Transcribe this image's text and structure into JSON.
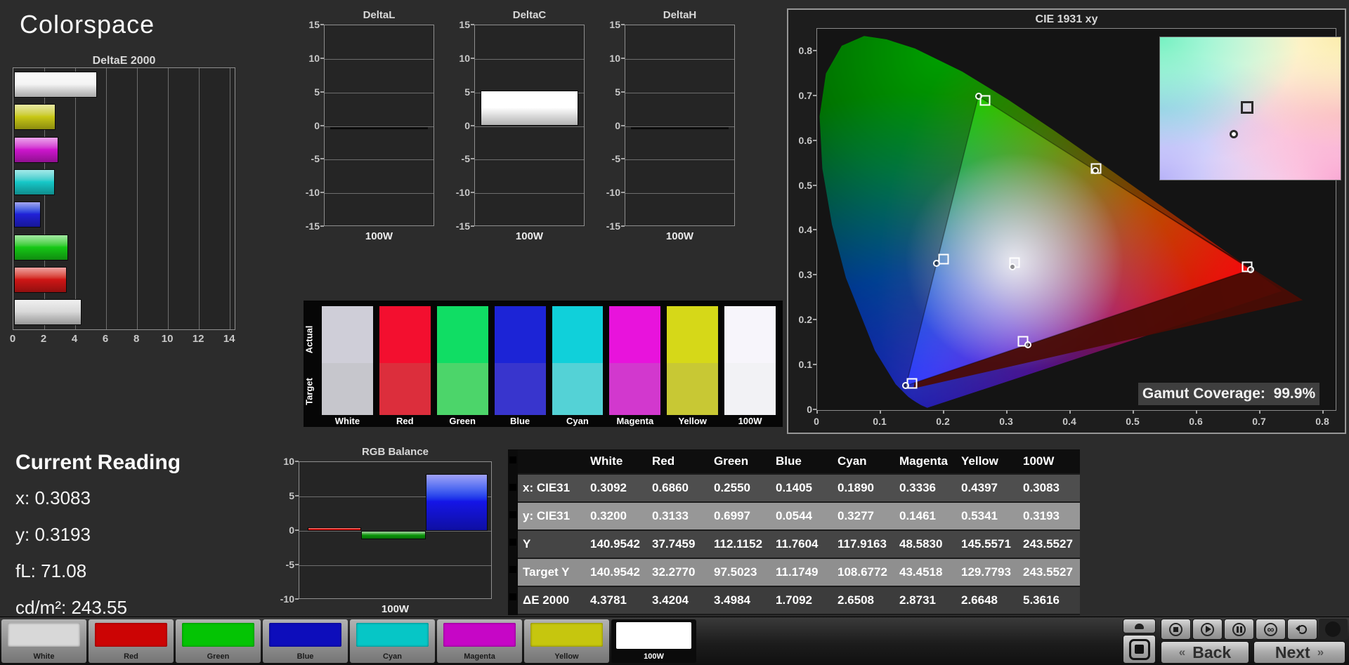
{
  "app": {
    "title": "Colorspace"
  },
  "current_reading": {
    "title": "Current Reading",
    "lines": [
      "x: 0.3083",
      "y: 0.3193",
      "fL: 71.08",
      "cd/m²: 243.55"
    ]
  },
  "chart_data": [
    {
      "id": "deltae2000",
      "type": "bar",
      "orientation": "horizontal",
      "title": "DeltaE 2000",
      "xlim": [
        0,
        14.4
      ],
      "xticks": [
        0,
        2,
        4,
        6,
        8,
        10,
        12,
        14
      ],
      "categories": [
        "100W",
        "Yellow",
        "Magenta",
        "Cyan",
        "Blue",
        "Green",
        "Red",
        "White"
      ],
      "values": [
        5.3616,
        2.6648,
        2.8731,
        2.6508,
        1.7092,
        3.4984,
        3.4204,
        4.3781
      ],
      "bar_colors": [
        "#f4f4f4",
        "#c9c916",
        "#ce16ce",
        "#16c9c9",
        "#2121d8",
        "#16c916",
        "#d01616",
        "#d9d9d9"
      ]
    },
    {
      "id": "delta_l",
      "type": "bar",
      "title": "DeltaL",
      "categories": [
        "100W"
      ],
      "values": [
        0.0
      ],
      "ylim": [
        -15,
        15
      ],
      "yticks": [
        15,
        10,
        5,
        0,
        -5,
        -10,
        -15
      ],
      "xlabel": "100W",
      "bar_color": "#ffffff"
    },
    {
      "id": "delta_c",
      "type": "bar",
      "title": "DeltaC",
      "categories": [
        "100W"
      ],
      "values": [
        5.3
      ],
      "ylim": [
        -15,
        15
      ],
      "yticks": [
        15,
        10,
        5,
        0,
        -5,
        -10,
        -15
      ],
      "xlabel": "100W",
      "bar_color": "#ffffff"
    },
    {
      "id": "delta_h",
      "type": "bar",
      "title": "DeltaH",
      "categories": [
        "100W"
      ],
      "values": [
        0.0
      ],
      "ylim": [
        -15,
        15
      ],
      "yticks": [
        15,
        10,
        5,
        0,
        -5,
        -10,
        -15
      ],
      "xlabel": "100W",
      "bar_color": "#ffffff"
    },
    {
      "id": "rgb_balance",
      "type": "bar",
      "title": "RGB Balance",
      "categories": [
        "Red",
        "Green",
        "Blue"
      ],
      "values": [
        0.5,
        -1.2,
        8.3
      ],
      "ylim": [
        -10,
        10
      ],
      "yticks": [
        10,
        5,
        0,
        -5,
        -10
      ],
      "xlabel": "100W",
      "bar_colors": [
        "#e00a0a",
        "#0b9a0b",
        "#1515e8"
      ]
    },
    {
      "id": "cie1931",
      "type": "scatter",
      "title": "CIE 1931 xy",
      "xlim": [
        0,
        0.82
      ],
      "ylim": [
        0,
        0.85
      ],
      "xticks": [
        "0",
        "0.1",
        "0.2",
        "0.3",
        "0.4",
        "0.5",
        "0.6",
        "0.7",
        "0.8"
      ],
      "yticks": [
        "0.8",
        "0.7",
        "0.6",
        "0.5",
        "0.4",
        "0.3",
        "0.2",
        "0.1",
        "0"
      ],
      "gamut_coverage": {
        "label": "Gamut Coverage:",
        "value": "99.9%"
      },
      "triangle": [
        [
          0.686,
          0.3133
        ],
        [
          0.255,
          0.6997
        ],
        [
          0.1405,
          0.0544
        ]
      ],
      "reference_triangle": [
        [
          0.768,
          0.245
        ],
        [
          0.262,
          0.69
        ],
        [
          0.152,
          0.048
        ]
      ],
      "points": [
        {
          "name": "White",
          "target": [
            0.3127,
            0.329
          ],
          "measured": [
            0.3092,
            0.32
          ]
        },
        {
          "name": "Red",
          "target": [
            0.68,
            0.32
          ],
          "measured": [
            0.686,
            0.3133
          ]
        },
        {
          "name": "Green",
          "target": [
            0.265,
            0.69
          ],
          "measured": [
            0.255,
            0.6997
          ]
        },
        {
          "name": "Blue",
          "target": [
            0.15,
            0.06
          ],
          "measured": [
            0.1405,
            0.0544
          ]
        },
        {
          "name": "Cyan",
          "target": [
            0.2,
            0.337
          ],
          "measured": [
            0.189,
            0.3277
          ]
        },
        {
          "name": "Magenta",
          "target": [
            0.326,
            0.154
          ],
          "measured": [
            0.3336,
            0.1461
          ]
        },
        {
          "name": "Yellow",
          "target": [
            0.441,
            0.538
          ],
          "measured": [
            0.4397,
            0.5341
          ]
        }
      ]
    },
    {
      "id": "measurements",
      "type": "table",
      "columns": [
        "White",
        "Red",
        "Green",
        "Blue",
        "Cyan",
        "Magenta",
        "Yellow",
        "100W"
      ],
      "rows": [
        {
          "label": "x: CIE31",
          "values": [
            "0.3092",
            "0.6860",
            "0.2550",
            "0.1405",
            "0.1890",
            "0.3336",
            "0.4397",
            "0.3083"
          ]
        },
        {
          "label": "y: CIE31",
          "values": [
            "0.3200",
            "0.3133",
            "0.6997",
            "0.0544",
            "0.3277",
            "0.1461",
            "0.5341",
            "0.3193"
          ]
        },
        {
          "label": "Y",
          "values": [
            "140.9542",
            "37.7459",
            "112.1152",
            "11.7604",
            "117.9163",
            "48.5830",
            "145.5571",
            "243.5527"
          ]
        },
        {
          "label": "Target Y",
          "values": [
            "140.9542",
            "32.2770",
            "97.5023",
            "11.1749",
            "108.6772",
            "43.4518",
            "129.7793",
            "243.5527"
          ]
        },
        {
          "label": "ΔE 2000",
          "values": [
            "4.3781",
            "3.4204",
            "3.4984",
            "1.7092",
            "2.6508",
            "2.8731",
            "2.6648",
            "5.3616"
          ]
        }
      ]
    }
  ],
  "swatches": {
    "actual_label": "Actual",
    "target_label": "Target",
    "items": [
      {
        "name": "White",
        "actual": "#cfced8",
        "target": "#c6c6cc"
      },
      {
        "name": "Red",
        "actual": "#f30f2f",
        "target": "#dc2e3c"
      },
      {
        "name": "Green",
        "actual": "#10dd64",
        "target": "#4cd56a"
      },
      {
        "name": "Blue",
        "actual": "#1c24d6",
        "target": "#3835cd"
      },
      {
        "name": "Cyan",
        "actual": "#10d0da",
        "target": "#54d2d6"
      },
      {
        "name": "Magenta",
        "actual": "#e813dc",
        "target": "#d238ce"
      },
      {
        "name": "Yellow",
        "actual": "#d6d818",
        "target": "#c8c834"
      },
      {
        "name": "100W",
        "actual": "#f7f5fb",
        "target": "#f2f2f5"
      }
    ]
  },
  "bottom_bar": {
    "buttons": [
      {
        "name": "White",
        "color": "#d8d8d8",
        "selected": false
      },
      {
        "name": "Red",
        "color": "#cc0404",
        "selected": false
      },
      {
        "name": "Green",
        "color": "#04c404",
        "selected": false
      },
      {
        "name": "Blue",
        "color": "#0d0dbb",
        "selected": false
      },
      {
        "name": "Cyan",
        "color": "#06c6c6",
        "selected": false
      },
      {
        "name": "Magenta",
        "color": "#c606c6",
        "selected": false
      },
      {
        "name": "Yellow",
        "color": "#c6c60e",
        "selected": false
      },
      {
        "name": "100W",
        "color": "#ffffff",
        "selected": true
      }
    ]
  },
  "controls": {
    "back_label": "Back",
    "next_label": "Next",
    "back_chevron": "«",
    "next_chevron": "»",
    "icons": [
      "stop",
      "play",
      "pause",
      "loop",
      "refresh"
    ]
  }
}
